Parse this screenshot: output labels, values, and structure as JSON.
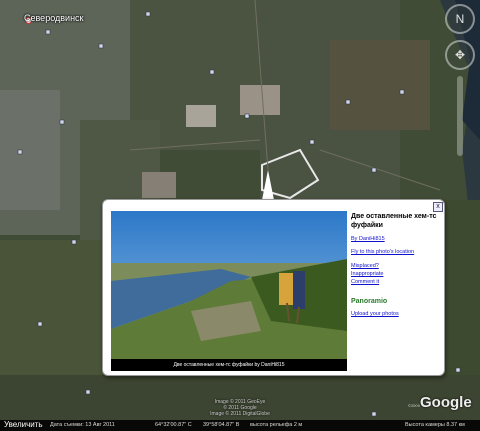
{
  "map": {
    "city_label": "Северодвинск",
    "icons": {
      "nav": "navigation-compass-icon",
      "pan": "pan-control-icon",
      "photo_marker": "photo-marker-icon"
    }
  },
  "popup": {
    "title": "Две оставленные хем-тс фуфайки",
    "author": "By DaniHi815",
    "fly_link": "Fly to this photo's location",
    "misplaced": "Misplaced?",
    "inappropriate": "Inappropriate",
    "comment": "Comment it",
    "panoramio": "Panoramio",
    "upload": "Upload your photos",
    "caption": "Две оставленные хем-тс фуфайки  by DaniHi815",
    "close_glyph": "x"
  },
  "footer": {
    "credit1": "Image © 2011 GeoEye",
    "credit2": "© 2011 Google",
    "credit3": "Image © 2011 DigitalGlobe",
    "year": "©2009",
    "google_logo": "Google",
    "zoom_label": "Увеличить",
    "status_date": "Дата съемки: 13 Авг 2011",
    "status_lat": "64°32'00.87\" С",
    "status_lon": "39°58'04.87\" В",
    "status_alt": "высота рельефа  2 м",
    "status_eye": "Высота камеры  8.37 км"
  },
  "colors": {
    "link": "#1111cc",
    "panoramio_green": "#2b7a2b",
    "panoramio_blue": "#1c6ec4"
  }
}
